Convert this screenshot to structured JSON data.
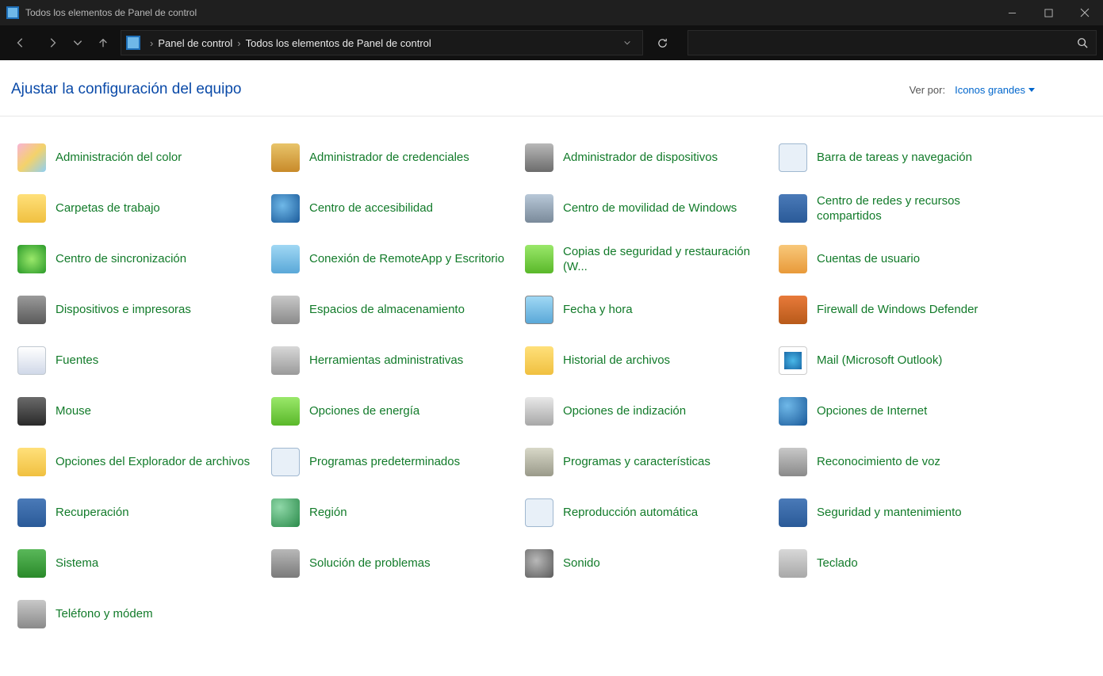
{
  "window_title": "Todos los elementos de Panel de control",
  "breadcrumb": {
    "level1": "Panel de control",
    "level2": "Todos los elementos de Panel de control"
  },
  "page_title": "Ajustar la configuración del equipo",
  "view_label": "Ver por:",
  "view_value": "Iconos grandes",
  "items": [
    {
      "label": "Administración del color",
      "icon": "c1",
      "name": "color-management"
    },
    {
      "label": "Administrador de credenciales",
      "icon": "c2",
      "name": "credential-manager"
    },
    {
      "label": "Administrador de dispositivos",
      "icon": "c3",
      "name": "device-manager"
    },
    {
      "label": "Barra de tareas y navegación",
      "icon": "c4",
      "name": "taskbar-navigation"
    },
    {
      "label": "Carpetas de trabajo",
      "icon": "c5",
      "name": "work-folders"
    },
    {
      "label": "Centro de accesibilidad",
      "icon": "c6",
      "name": "ease-of-access"
    },
    {
      "label": "Centro de movilidad de Windows",
      "icon": "c7",
      "name": "mobility-center"
    },
    {
      "label": "Centro de redes y recursos compartidos",
      "icon": "c8",
      "name": "network-sharing"
    },
    {
      "label": "Centro de sincronización",
      "icon": "c9",
      "name": "sync-center"
    },
    {
      "label": "Conexión de RemoteApp y Escritorio",
      "icon": "c10",
      "name": "remoteapp"
    },
    {
      "label": "Copias de seguridad y restauración (W...",
      "icon": "c11",
      "name": "backup-restore"
    },
    {
      "label": "Cuentas de usuario",
      "icon": "c12",
      "name": "user-accounts"
    },
    {
      "label": "Dispositivos e impresoras",
      "icon": "c13",
      "name": "devices-printers"
    },
    {
      "label": "Espacios de almacenamiento",
      "icon": "c14",
      "name": "storage-spaces"
    },
    {
      "label": "Fecha y hora",
      "icon": "c15",
      "name": "date-time"
    },
    {
      "label": "Firewall de Windows Defender",
      "icon": "c16",
      "name": "windows-firewall"
    },
    {
      "label": "Fuentes",
      "icon": "c17",
      "name": "fonts"
    },
    {
      "label": "Herramientas administrativas",
      "icon": "c18",
      "name": "admin-tools"
    },
    {
      "label": "Historial de archivos",
      "icon": "c19",
      "name": "file-history"
    },
    {
      "label": "Mail (Microsoft Outlook)",
      "icon": "c20",
      "name": "mail-outlook"
    },
    {
      "label": "Mouse",
      "icon": "c21",
      "name": "mouse"
    },
    {
      "label": "Opciones de energía",
      "icon": "c22",
      "name": "power-options"
    },
    {
      "label": "Opciones de indización",
      "icon": "c23",
      "name": "indexing-options"
    },
    {
      "label": "Opciones de Internet",
      "icon": "c24",
      "name": "internet-options"
    },
    {
      "label": "Opciones del Explorador de archivos",
      "icon": "c25",
      "name": "file-explorer-options"
    },
    {
      "label": "Programas predeterminados",
      "icon": "c26",
      "name": "default-programs"
    },
    {
      "label": "Programas y características",
      "icon": "c27",
      "name": "programs-features"
    },
    {
      "label": "Reconocimiento de voz",
      "icon": "c28",
      "name": "speech-recognition"
    },
    {
      "label": "Recuperación",
      "icon": "c29",
      "name": "recovery"
    },
    {
      "label": "Región",
      "icon": "c30",
      "name": "region"
    },
    {
      "label": "Reproducción automática",
      "icon": "c31",
      "name": "autoplay"
    },
    {
      "label": "Seguridad y mantenimiento",
      "icon": "c32",
      "name": "security-maintenance"
    },
    {
      "label": "Sistema",
      "icon": "c33",
      "name": "system"
    },
    {
      "label": "Solución de problemas",
      "icon": "c34",
      "name": "troubleshooting"
    },
    {
      "label": "Sonido",
      "icon": "c35",
      "name": "sound"
    },
    {
      "label": "Teclado",
      "icon": "c36",
      "name": "keyboard"
    },
    {
      "label": "Teléfono y módem",
      "icon": "c37",
      "name": "phone-modem"
    }
  ]
}
